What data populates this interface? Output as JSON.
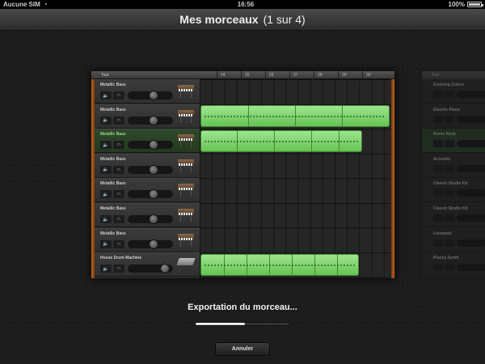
{
  "status_bar": {
    "carrier": "Aucune SIM",
    "time": "16:56",
    "battery": "100%"
  },
  "title_bar": {
    "title": "Mes morceaux",
    "subtitle": "(1 sur 4)"
  },
  "song_card": {
    "header_label": "Tout",
    "bar_numbers": [
      "24",
      "25",
      "26",
      "27",
      "28",
      "29",
      "30"
    ],
    "tracks": [
      {
        "name": "Metallic Bass",
        "selected": false,
        "instrument_icon": "keyboard-icon",
        "volume": 0.6
      },
      {
        "name": "Metallic Bass",
        "selected": false,
        "instrument_icon": "keyboard-icon",
        "volume": 0.6
      },
      {
        "name": "Metallic Bass",
        "selected": true,
        "instrument_icon": "keyboard-icon",
        "volume": 0.6
      },
      {
        "name": "Metallic Bass",
        "selected": false,
        "instrument_icon": "keyboard-icon",
        "volume": 0.6
      },
      {
        "name": "Metallic Bass",
        "selected": false,
        "instrument_icon": "keyboard-icon",
        "volume": 0.6
      },
      {
        "name": "Metallic Bass",
        "selected": false,
        "instrument_icon": "keyboard-icon",
        "volume": 0.6
      },
      {
        "name": "Metallic Bass",
        "selected": false,
        "instrument_icon": "keyboard-icon",
        "volume": 0.6
      },
      {
        "name": "House Drum Machine",
        "selected": false,
        "instrument_icon": "drum-machine-icon",
        "volume": 0.9
      }
    ]
  },
  "next_song_card": {
    "header_label": "Tout",
    "tracks": [
      {
        "name": "Evolving Colors",
        "selected": false
      },
      {
        "name": "Electric Piano",
        "selected": false
      },
      {
        "name": "Roots Rock",
        "selected": true
      },
      {
        "name": "Acoustic",
        "selected": false
      },
      {
        "name": "Classic Studio Kit",
        "selected": false
      },
      {
        "name": "Classic Studio Kit",
        "selected": false
      },
      {
        "name": "Liverpool",
        "selected": false
      },
      {
        "name": "Plucky Synth",
        "selected": false
      }
    ]
  },
  "export": {
    "label": "Exportation du morceau...",
    "progress": 0.53,
    "cancel_label": "Annuler"
  },
  "colors": {
    "region_green": "#7fd46e",
    "track_edge_orange": "#c0661e",
    "selected_track": "#2e4a2c"
  }
}
